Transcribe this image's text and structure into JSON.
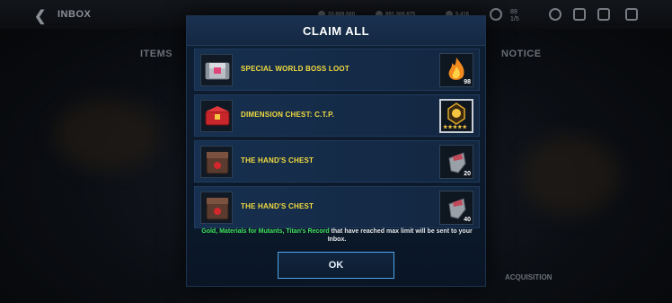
{
  "background": {
    "back_icon": "chevron-left-icon",
    "screen_title": "INBOX",
    "resources": [
      {
        "name": "resource-1",
        "value": "33,669,560"
      },
      {
        "name": "resource-2",
        "value": "891,306,875"
      },
      {
        "name": "resource-3",
        "value": "5,416"
      }
    ],
    "timer": {
      "value": "89",
      "sub": "1/5"
    },
    "tabs": [
      "ITEMS",
      "NOTICE"
    ],
    "sort_label": "ACQUISITION"
  },
  "dialog": {
    "title": "CLAIM ALL",
    "rows": [
      {
        "label": "SPECIAL WORLD BOSS LOOT",
        "chest_icon": "silver-chest-icon",
        "reward_icon": "flame-icon",
        "qty": "98",
        "selected": false
      },
      {
        "label": "DIMENSION CHEST: C.T.P.",
        "chest_icon": "red-chest-icon",
        "reward_icon": "emblem-icon",
        "qty": "",
        "stars": "★★★★★",
        "selected": true
      },
      {
        "label": "THE HAND'S CHEST",
        "chest_icon": "dark-chest-icon",
        "reward_icon": "pouch-icon",
        "qty": "20",
        "selected": false
      },
      {
        "label": "THE HAND'S CHEST",
        "chest_icon": "dark-chest-icon",
        "reward_icon": "pouch-icon",
        "qty": "40",
        "selected": false
      }
    ],
    "note_highlight": "Gold, Materials for Mutants, Titan's Record",
    "note_rest": " that have reached max limit will be sent to your Inbox.",
    "ok_label": "OK"
  },
  "colors": {
    "label_yellow": "#f3dc3f",
    "highlight_green": "#3fe35a",
    "ok_border": "#4aa6e8"
  }
}
